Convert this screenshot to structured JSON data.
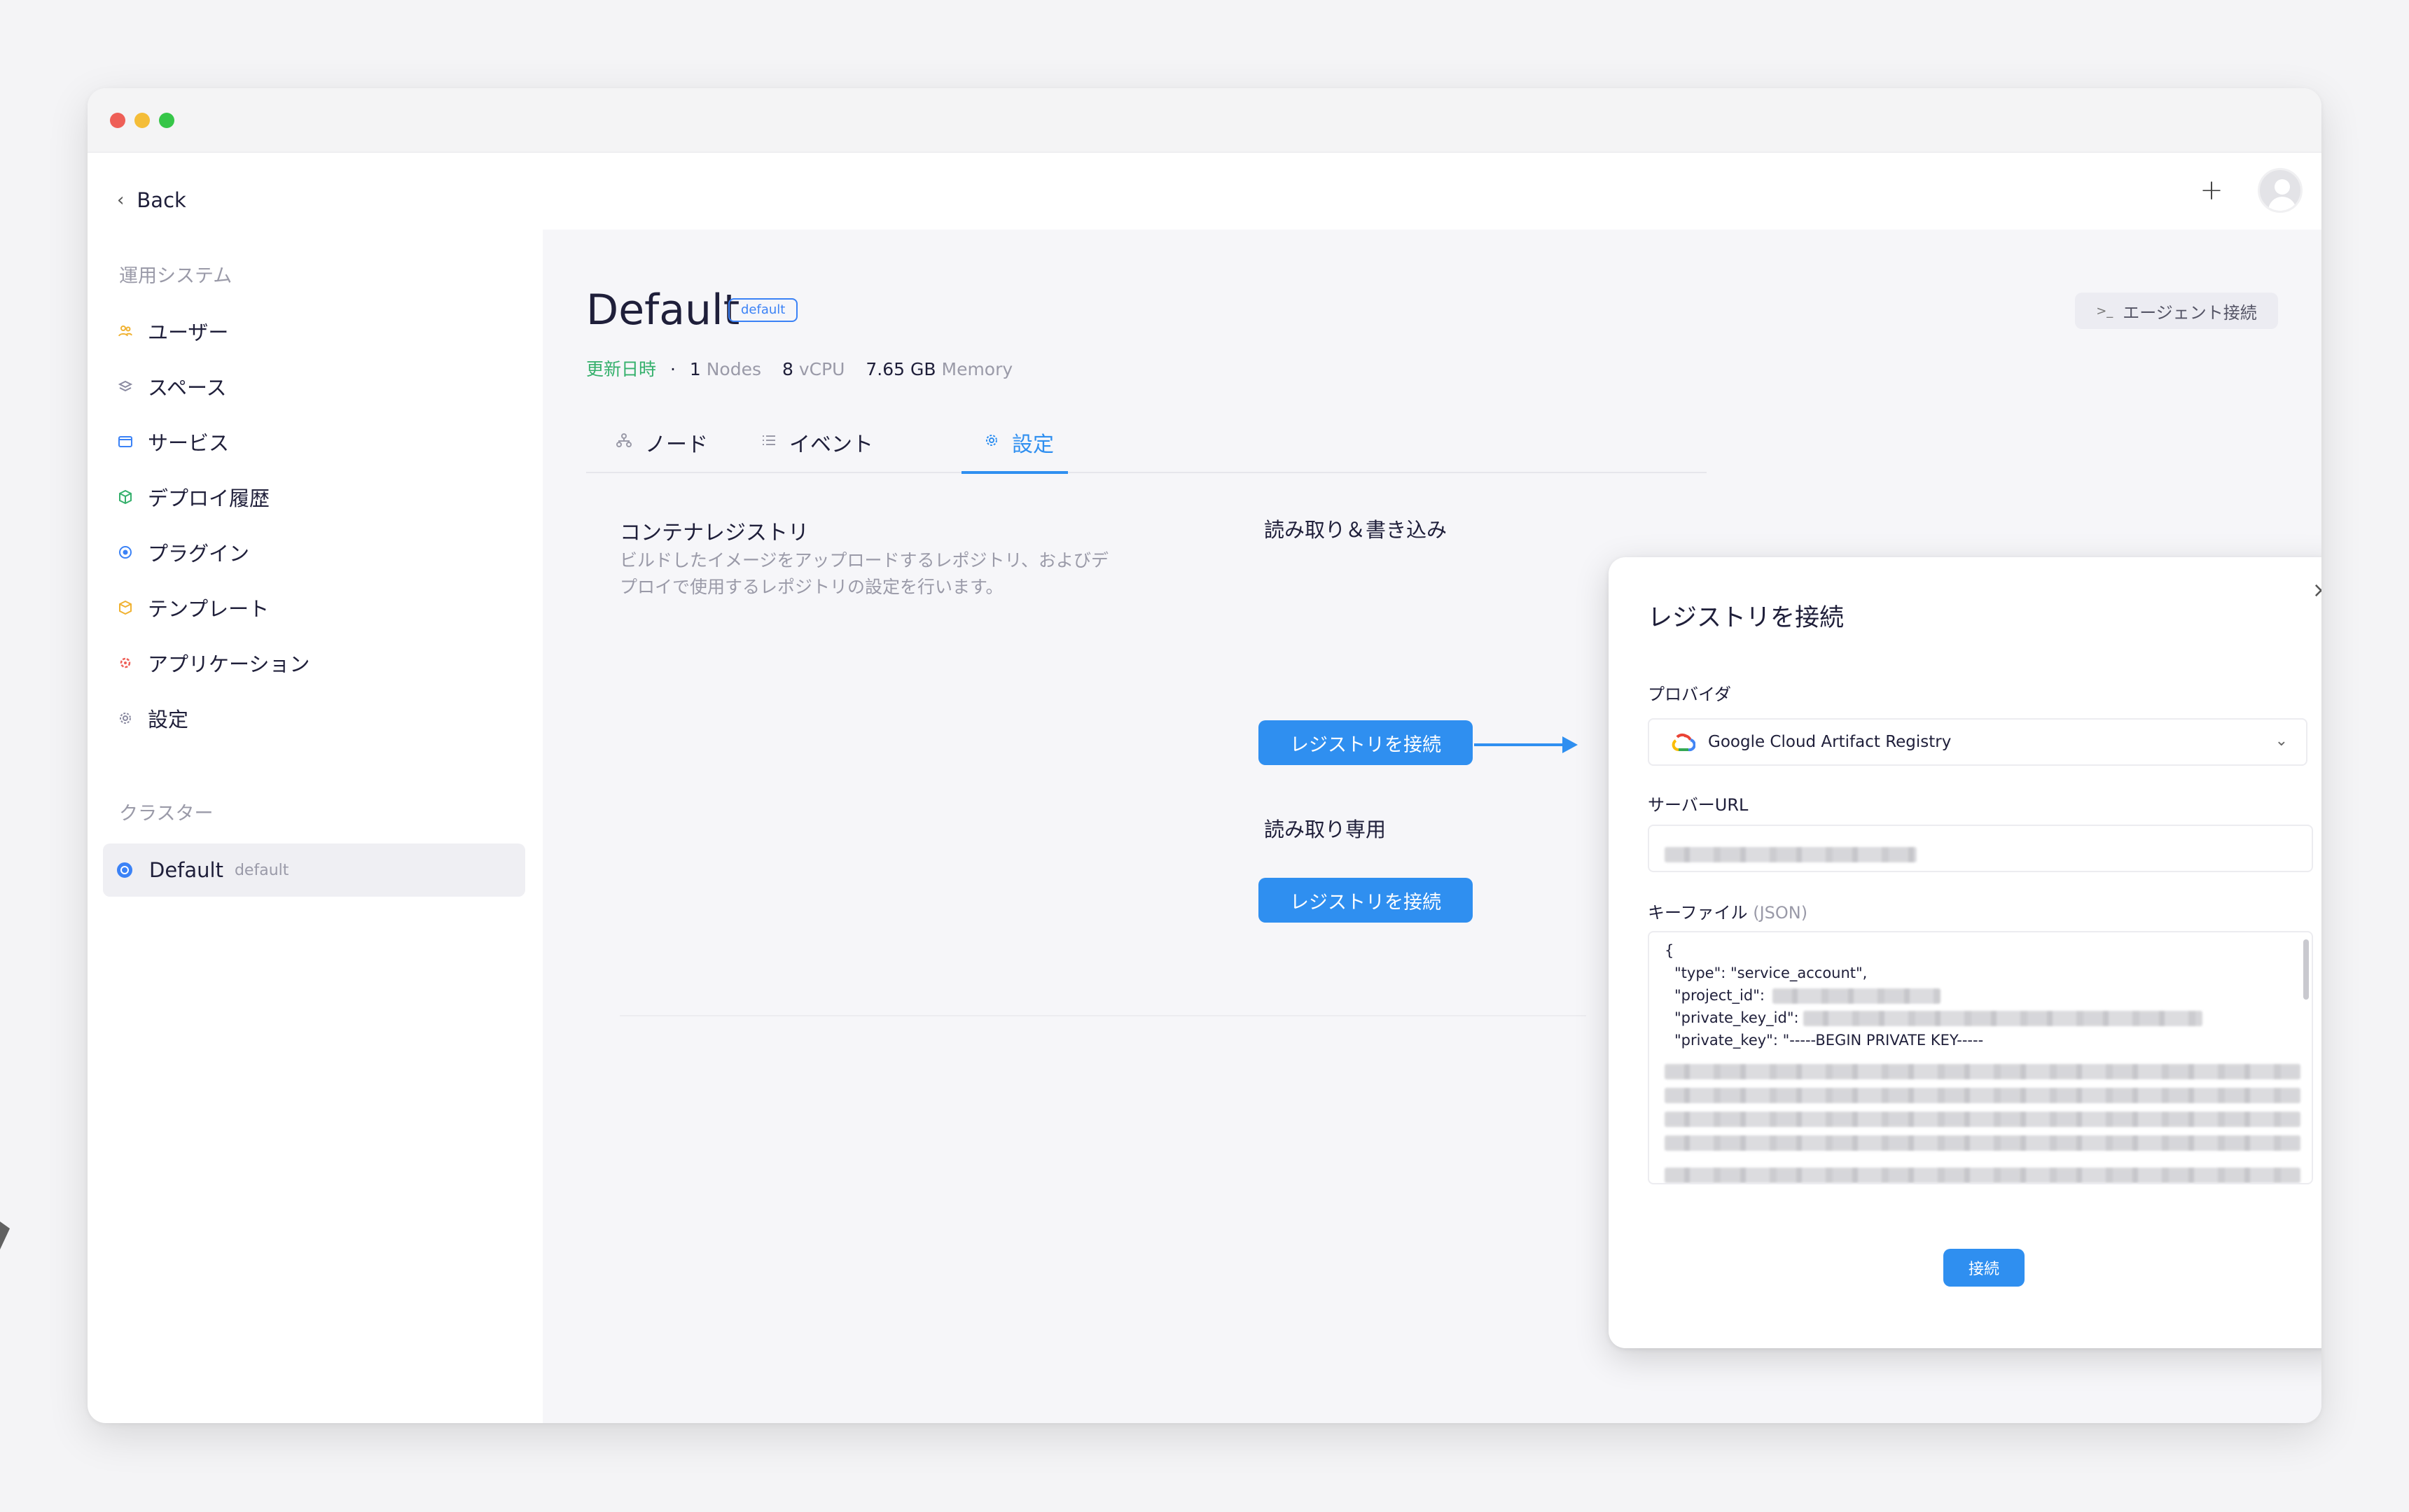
{
  "header": {
    "plus_label": "+"
  },
  "sidebar": {
    "back_label": "Back",
    "ops_section": "運用システム",
    "items": [
      {
        "label": "ユーザー",
        "icon": "users-icon",
        "color": "#f0b232"
      },
      {
        "label": "スペース",
        "icon": "layers-icon",
        "color": "#8a8aa0"
      },
      {
        "label": "サービス",
        "icon": "window-icon",
        "color": "#3b82f6"
      },
      {
        "label": "デプロイ履歴",
        "icon": "box-icon",
        "color": "#35b06c"
      },
      {
        "label": "プラグイン",
        "icon": "plugin-icon",
        "color": "#3b82f6"
      },
      {
        "label": "テンプレート",
        "icon": "template-icon",
        "color": "#f0b232"
      },
      {
        "label": "アプリケーション",
        "icon": "app-icon",
        "color": "#ee5f57"
      },
      {
        "label": "設定",
        "icon": "gear-icon",
        "color": "#8a8aa0"
      }
    ],
    "cluster_section": "クラスター",
    "cluster": {
      "label": "Default",
      "sub": "default"
    }
  },
  "main": {
    "title": "Default",
    "title_badge": "default",
    "stats": {
      "updated": "更新日時",
      "dot": "·",
      "nodes_value": "1",
      "nodes_label": "Nodes",
      "vcpu_value": "8",
      "vcpu_label": "vCPU",
      "memory_value": "7.65 GB",
      "memory_label": "Memory"
    },
    "agent_button": "エージェント接続",
    "agent_icon_glyph": ">_",
    "tabs": [
      {
        "label": "ノード",
        "icon": "nodes-icon"
      },
      {
        "label": "イベント",
        "icon": "list-icon"
      },
      {
        "label": "設定",
        "icon": "gear-icon"
      }
    ],
    "registry": {
      "title": "コンテナレジストリ",
      "description": "ビルドしたイメージをアップロードするレポジトリ、およびデプロイで使用するレポジトリの設定を行います。",
      "rw_label": "読み取り＆書き込み",
      "ro_label": "読み取り専用",
      "connect_label": "レジストリを接続"
    }
  },
  "modal": {
    "title": "レジストリを接続",
    "close_glyph": "×",
    "provider_label": "プロバイダ",
    "provider_value": "Google Cloud Artifact Registry",
    "server_url_label": "サーバーURL",
    "keyfile_label": "キーファイル",
    "keyfile_hint": "(JSON)",
    "code": {
      "brace": "{",
      "type_line": "\"type\": \"service_account\",",
      "project_line": "\"project_id\":",
      "private_key_id_line": "\"private_key_id\":",
      "private_key_line": "\"private_key\": \"-----BEGIN PRIVATE KEY-----"
    },
    "submit_label": "接続"
  },
  "colors": {
    "accent": "#2f8ff0",
    "updated": "#35b06c"
  }
}
